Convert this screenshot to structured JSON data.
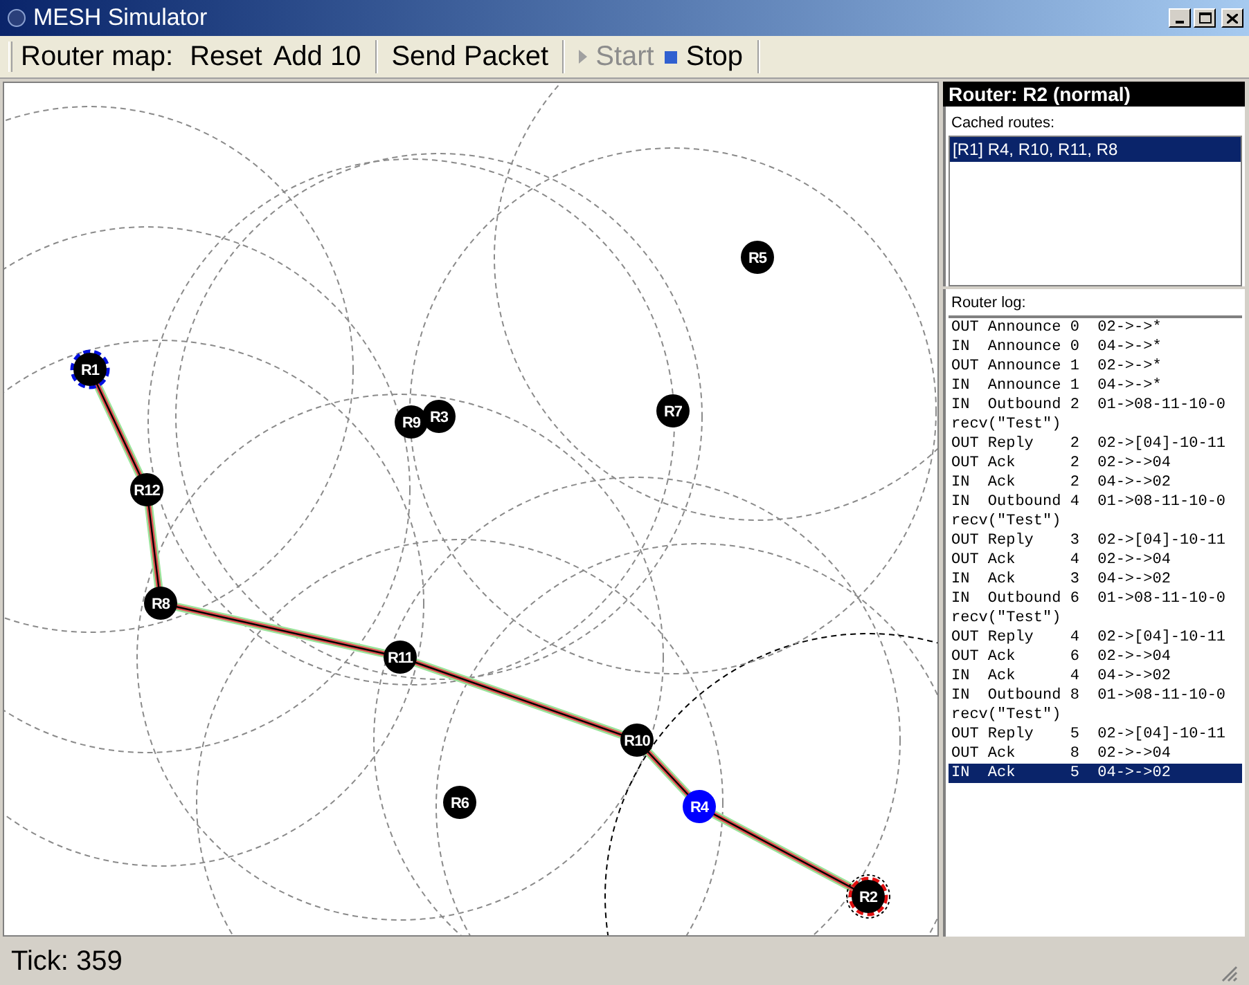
{
  "window": {
    "title": "MESH Simulator"
  },
  "toolbar": {
    "label": "Router map:",
    "groups": [
      [
        {
          "label": "Reset",
          "disabled": false,
          "kind": "text"
        },
        {
          "label": "Add 10",
          "disabled": false,
          "kind": "text"
        }
      ],
      [
        {
          "label": "Send Packet",
          "disabled": false,
          "kind": "text"
        }
      ],
      [
        {
          "label": "Start",
          "disabled": true,
          "kind": "play"
        },
        {
          "label": "Stop",
          "disabled": false,
          "kind": "stop"
        }
      ]
    ]
  },
  "map": {
    "routers": [
      {
        "name": "R1",
        "color": "#000000",
        "source": true,
        "selected": false,
        "on_route": true
      },
      {
        "name": "R12",
        "color": "#000000",
        "source": false,
        "selected": false,
        "on_route": true
      },
      {
        "name": "R8",
        "color": "#000000",
        "source": false,
        "selected": false,
        "on_route": true
      },
      {
        "name": "R11",
        "color": "#000000",
        "source": false,
        "selected": false,
        "on_route": true
      },
      {
        "name": "R10",
        "color": "#000000",
        "source": false,
        "selected": false,
        "on_route": true
      },
      {
        "name": "R4",
        "color": "#0000ff",
        "source": false,
        "selected": false,
        "on_route": true
      },
      {
        "name": "R2",
        "color": "#000000",
        "source": false,
        "selected": true,
        "on_route": true
      },
      {
        "name": "R6",
        "color": "#000000",
        "source": false,
        "selected": false,
        "on_route": false
      },
      {
        "name": "R9",
        "color": "#000000",
        "source": false,
        "selected": false,
        "on_route": false
      },
      {
        "name": "R3",
        "color": "#000000",
        "source": false,
        "selected": false,
        "on_route": false
      },
      {
        "name": "R7",
        "color": "#000000",
        "source": false,
        "selected": false,
        "on_route": false
      },
      {
        "name": "R5",
        "color": "#000000",
        "source": false,
        "selected": false,
        "on_route": false
      }
    ]
  },
  "sidebar": {
    "title": "Router: R2 (normal)",
    "cached_label": "Cached routes:",
    "cached_routes": [
      {
        "text": "[R1] R4, R10, R11, R8",
        "selected": true
      }
    ],
    "log_label": "Router log:",
    "log": [
      {
        "text": "OUT Announce 0  02->->*",
        "selected": false
      },
      {
        "text": "IN  Announce 0  04->->*",
        "selected": false
      },
      {
        "text": "OUT Announce 1  02->->*",
        "selected": false
      },
      {
        "text": "IN  Announce 1  04->->*",
        "selected": false
      },
      {
        "text": "IN  Outbound 2  01->08-11-10-0",
        "selected": false
      },
      {
        "text": "recv(\"Test\")",
        "selected": false
      },
      {
        "text": "OUT Reply    2  02->[04]-10-11",
        "selected": false
      },
      {
        "text": "OUT Ack      2  02->->04",
        "selected": false
      },
      {
        "text": "IN  Ack      2  04->->02",
        "selected": false
      },
      {
        "text": "IN  Outbound 4  01->08-11-10-0",
        "selected": false
      },
      {
        "text": "recv(\"Test\")",
        "selected": false
      },
      {
        "text": "OUT Reply    3  02->[04]-10-11",
        "selected": false
      },
      {
        "text": "OUT Ack      4  02->->04",
        "selected": false
      },
      {
        "text": "IN  Ack      3  04->->02",
        "selected": false
      },
      {
        "text": "IN  Outbound 6  01->08-11-10-0",
        "selected": false
      },
      {
        "text": "recv(\"Test\")",
        "selected": false
      },
      {
        "text": "OUT Reply    4  02->[04]-10-11",
        "selected": false
      },
      {
        "text": "OUT Ack      6  02->->04",
        "selected": false
      },
      {
        "text": "IN  Ack      4  04->->02",
        "selected": false
      },
      {
        "text": "IN  Outbound 8  01->08-11-10-0",
        "selected": false
      },
      {
        "text": "recv(\"Test\")",
        "selected": false
      },
      {
        "text": "OUT Reply    5  02->[04]-10-11",
        "selected": false
      },
      {
        "text": "OUT Ack      8  02->->04",
        "selected": false
      },
      {
        "text": "IN  Ack      5  04->->02",
        "selected": true
      }
    ]
  },
  "status_bar": {
    "text": "Tick: 359"
  }
}
